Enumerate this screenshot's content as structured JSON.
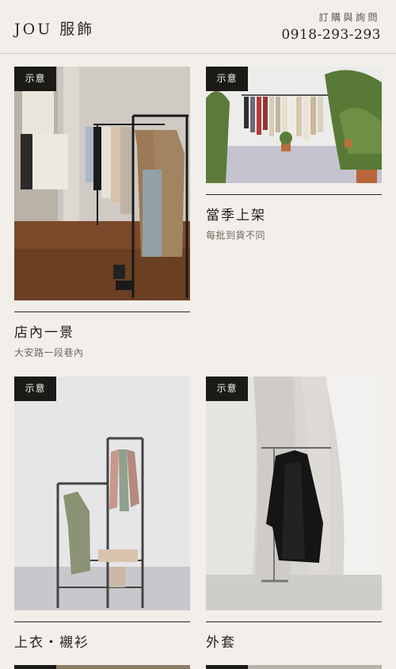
{
  "header": {
    "brand": "JOU 服飾",
    "order_label": "訂購與詢問",
    "phone": "0918-293-293"
  },
  "cards": [
    {
      "badge": "示意",
      "title": "店內一景",
      "subtitle": "大安路一段巷內"
    },
    {
      "badge": "示意",
      "title": "當季上架",
      "subtitle": "每批到貨不同"
    },
    {
      "badge": "示意",
      "title": "上衣・襯衫",
      "subtitle": ""
    },
    {
      "badge": "示意",
      "title": "外套",
      "subtitle": ""
    }
  ]
}
